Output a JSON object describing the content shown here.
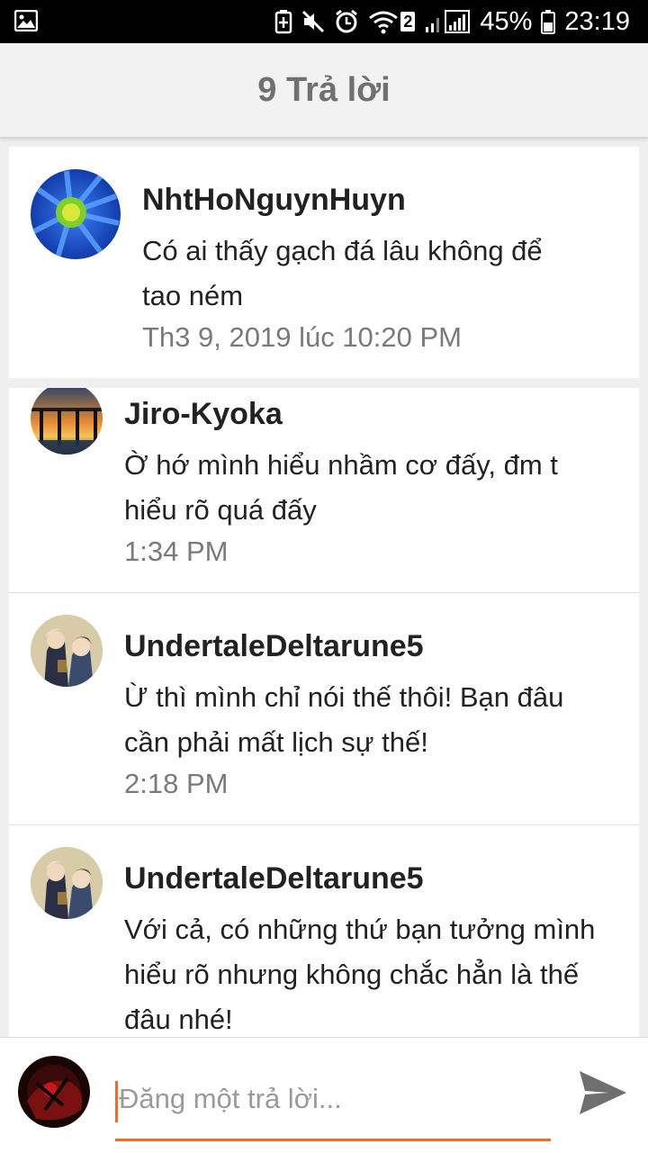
{
  "status_bar": {
    "battery": "45%",
    "time": "23:19",
    "wifi_badge": "2",
    "icons": [
      "gallery-icon",
      "battery-saver-icon",
      "mute-icon",
      "alarm-icon",
      "wifi-icon",
      "signal-icon",
      "battery-icon"
    ]
  },
  "header": {
    "title": "9 Trả lời"
  },
  "comments": [
    {
      "username": "NhtHoNguynHuyn",
      "text_lines": [
        "Có ai thấy gạch đá lâu không để",
        "tao ném"
      ],
      "timestamp": "Th3 9, 2019 lúc 10:20 PM",
      "avatar": "blue-flower"
    },
    {
      "username": "Jiro-Kyoka",
      "text_lines": [
        "Ờ hớ mình hiểu nhầm cơ đấy, đm t",
        "hiểu rõ quá đấy"
      ],
      "timestamp": "1:34 PM",
      "avatar": "bridge-sunset"
    },
    {
      "username": "UndertaleDeltarune5",
      "text_lines": [
        "Ừ thì mình chỉ nói thế thôi! Bạn đâu",
        "cần phải mất lịch sự thế!"
      ],
      "timestamp": "2:18 PM",
      "avatar": "anime-characters"
    },
    {
      "username": "UndertaleDeltarune5",
      "text_lines": [
        "Với cả, có những thứ bạn tưởng mình",
        "hiểu rõ nhưng không chắc hẳn là thế",
        "đâu nhé!"
      ],
      "timestamp": "",
      "avatar": "anime-characters"
    }
  ],
  "reply_input": {
    "placeholder": "Đăng một trả lời..."
  },
  "colors": {
    "accent": "#f26b21",
    "header_text": "#707070",
    "timestamp": "#7a7a7a"
  }
}
